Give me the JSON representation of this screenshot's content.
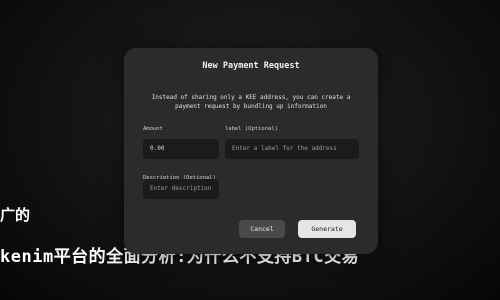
{
  "background": {
    "line1": "广的",
    "line2": "kenim平台的全面分析:为什么不支持BTC交易"
  },
  "dialog": {
    "title": "New Payment Request",
    "description": "Instead of sharing only a KEE address, you can create a payment request by bundling up information",
    "amount_label": "Amount",
    "amount_value": "0.00",
    "label_label": "label (Optional)",
    "label_placeholder": "Enter a label for the address",
    "description_label": "Description (Optional)",
    "description_placeholder": "Enter description",
    "cancel_label": "Cancel",
    "generate_label": "Generate"
  }
}
